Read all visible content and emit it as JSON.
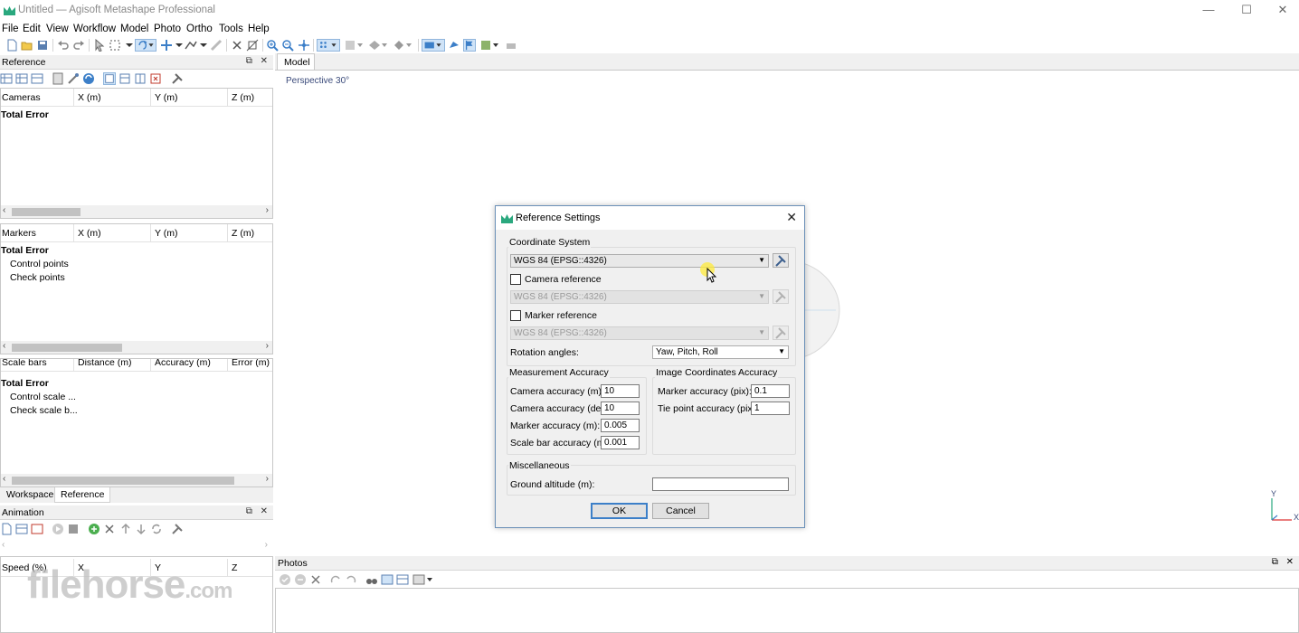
{
  "window": {
    "title": "Untitled — Agisoft Metashape Professional",
    "controls": [
      "—",
      "☐",
      "✕"
    ]
  },
  "menu": [
    "File",
    "Edit",
    "View",
    "Workflow",
    "Model",
    "Photo",
    "Ortho",
    "Tools",
    "Help"
  ],
  "reference_panel": {
    "title": "Reference",
    "buttons": "⧉ ✕",
    "cameras": {
      "columns": [
        "Cameras",
        "X (m)",
        "Y (m)",
        "Z (m)"
      ],
      "rows": [
        "Total Error"
      ]
    },
    "markers": {
      "columns": [
        "Markers",
        "X (m)",
        "Y (m)",
        "Z (m)"
      ],
      "rows": [
        "Total Error",
        "Control points",
        "Check points"
      ]
    },
    "scalebars": {
      "columns": [
        "Scale bars",
        "Distance (m)",
        "Accuracy (m)",
        "Error (m)"
      ],
      "rows": [
        "Total Error",
        "Control scale ...",
        "Check scale b..."
      ]
    }
  },
  "bottom_tabs": [
    "Workspace",
    "Reference"
  ],
  "animation_panel": {
    "title": "Animation",
    "buttons": "⧉ ✕",
    "columns": [
      "Speed (%)",
      "X",
      "Y",
      "Z"
    ]
  },
  "model_tab": "Model",
  "viewport": {
    "perspective_label": "Perspective 30°",
    "axis_y": "Y",
    "axis_x": "X"
  },
  "photos_panel": {
    "title": "Photos",
    "buttons": "⧉ ✕"
  },
  "dialog": {
    "title": "Reference Settings",
    "close": "✕",
    "coordinate_system": {
      "label": "Coordinate System",
      "value": "WGS 84 (EPSG::4326)",
      "camera_reference_label": "Camera reference",
      "camera_reference_value": "WGS 84 (EPSG::4326)",
      "marker_reference_label": "Marker reference",
      "marker_reference_value": "WGS 84 (EPSG::4326)",
      "rotation_angles_label": "Rotation angles:",
      "rotation_angles_value": "Yaw, Pitch, Roll"
    },
    "measurement_accuracy": {
      "label": "Measurement Accuracy",
      "camera_accuracy_m_label": "Camera accuracy (m):",
      "camera_accuracy_m": "10",
      "camera_accuracy_deg_label": "Camera accuracy (deg):",
      "camera_accuracy_deg": "10",
      "marker_accuracy_m_label": "Marker accuracy (m):",
      "marker_accuracy_m": "0.005",
      "scale_bar_accuracy_label": "Scale bar accuracy (m):",
      "scale_bar_accuracy": "0.001"
    },
    "image_coordinates_accuracy": {
      "label": "Image Coordinates Accuracy",
      "marker_accuracy_pix_label": "Marker accuracy (pix):",
      "marker_accuracy_pix": "0.1",
      "tie_point_accuracy_label": "Tie point accuracy (pix):",
      "tie_point_accuracy": "1"
    },
    "miscellaneous": {
      "label": "Miscellaneous",
      "ground_altitude_label": "Ground altitude (m):",
      "ground_altitude": ""
    },
    "ok_label": "OK",
    "cancel_label": "Cancel"
  },
  "watermark": {
    "text": "filehorse",
    "suffix": ".com"
  },
  "colors": {
    "accent": "#3c7fc8",
    "toolbar_icon": "#5a7fb0",
    "selected_bg": "#cfe3f7",
    "logo_green": "#2aa87e"
  }
}
